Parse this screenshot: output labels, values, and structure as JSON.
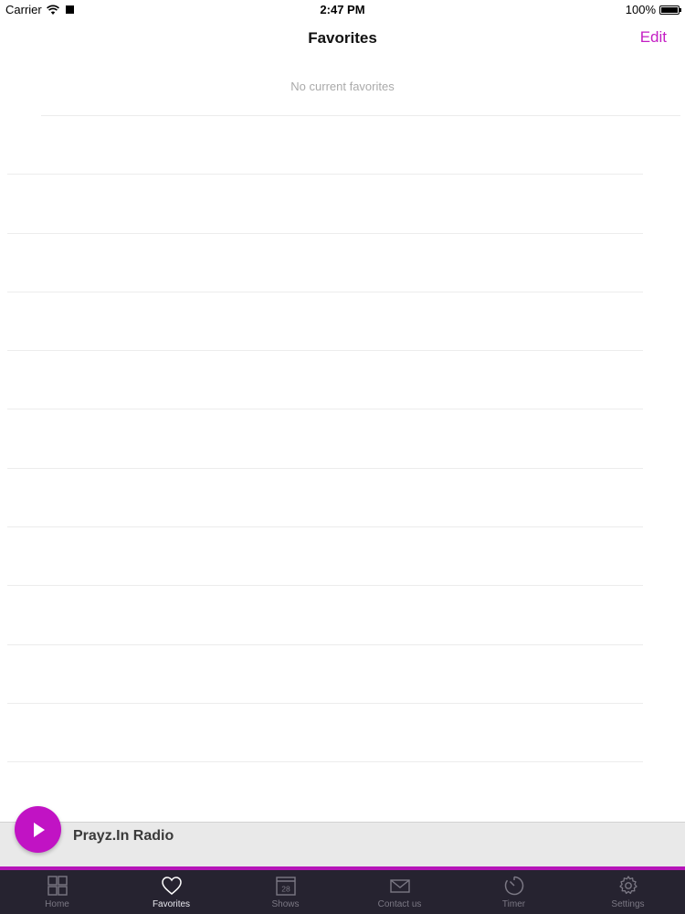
{
  "status_bar": {
    "carrier": "Carrier",
    "time": "2:47 PM",
    "battery": "100%"
  },
  "nav": {
    "title": "Favorites",
    "edit_label": "Edit"
  },
  "favorites": {
    "empty_message": "No current favorites"
  },
  "player": {
    "station_name": "Prayz.In Radio"
  },
  "tabs": [
    {
      "label": "Home",
      "icon": "grid-icon"
    },
    {
      "label": "Favorites",
      "icon": "heart-icon"
    },
    {
      "label": "Shows",
      "icon": "calendar-icon",
      "icon_text": "28"
    },
    {
      "label": "Contact us",
      "icon": "envelope-icon"
    },
    {
      "label": "Timer",
      "icon": "timer-icon"
    },
    {
      "label": "Settings",
      "icon": "gear-icon"
    }
  ],
  "colors": {
    "accent": "#c41ec4",
    "tab_bar": "#262330",
    "player_bar": "#e9e9e9"
  }
}
